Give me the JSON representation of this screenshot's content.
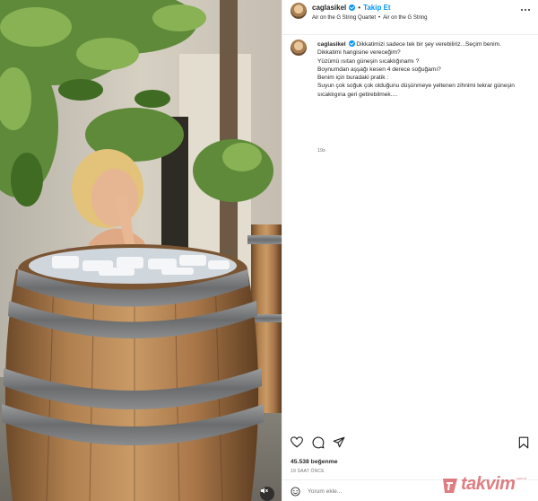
{
  "header": {
    "username": "caglasikel",
    "follow_label": "Takip Et",
    "dot": "•",
    "audio_artist": "Air on the G String Quartet",
    "audio_title": "Air on the G String"
  },
  "caption": {
    "username": "caglasikel",
    "lines": [
      "Dikkatimizi sadece tek bir şey verebiliriz...Seçim benim.",
      "Dikkatimi hangisine vereceğim?",
      "Yüzümü ısıtan güneşin sıcaklığınamı ?",
      "Boynumdan aşşağı kesen 4 derece soğuğamı?",
      "Benim için buradaki pratik :",
      "Suyun çok soğuk çok olduğunu düşünmeye yeltenen zihnimi tekrar güneşin sıcaklıgına geri getirebilmek...."
    ],
    "time": "19s"
  },
  "actions": {
    "like_icon": "heart-icon",
    "comment_icon": "comment-icon",
    "share_icon": "share-icon",
    "save_icon": "bookmark-icon"
  },
  "stats": {
    "likes": "45.538 beğenme",
    "date": "19 SAAT ÖNCE"
  },
  "comment": {
    "placeholder": "Yorum ekle..."
  },
  "watermark": {
    "brand": "takvim",
    "suffix": "com.tr"
  },
  "colors": {
    "accent": "#0095f6",
    "text": "#262626",
    "muted": "#737373",
    "divider": "#efefef"
  }
}
